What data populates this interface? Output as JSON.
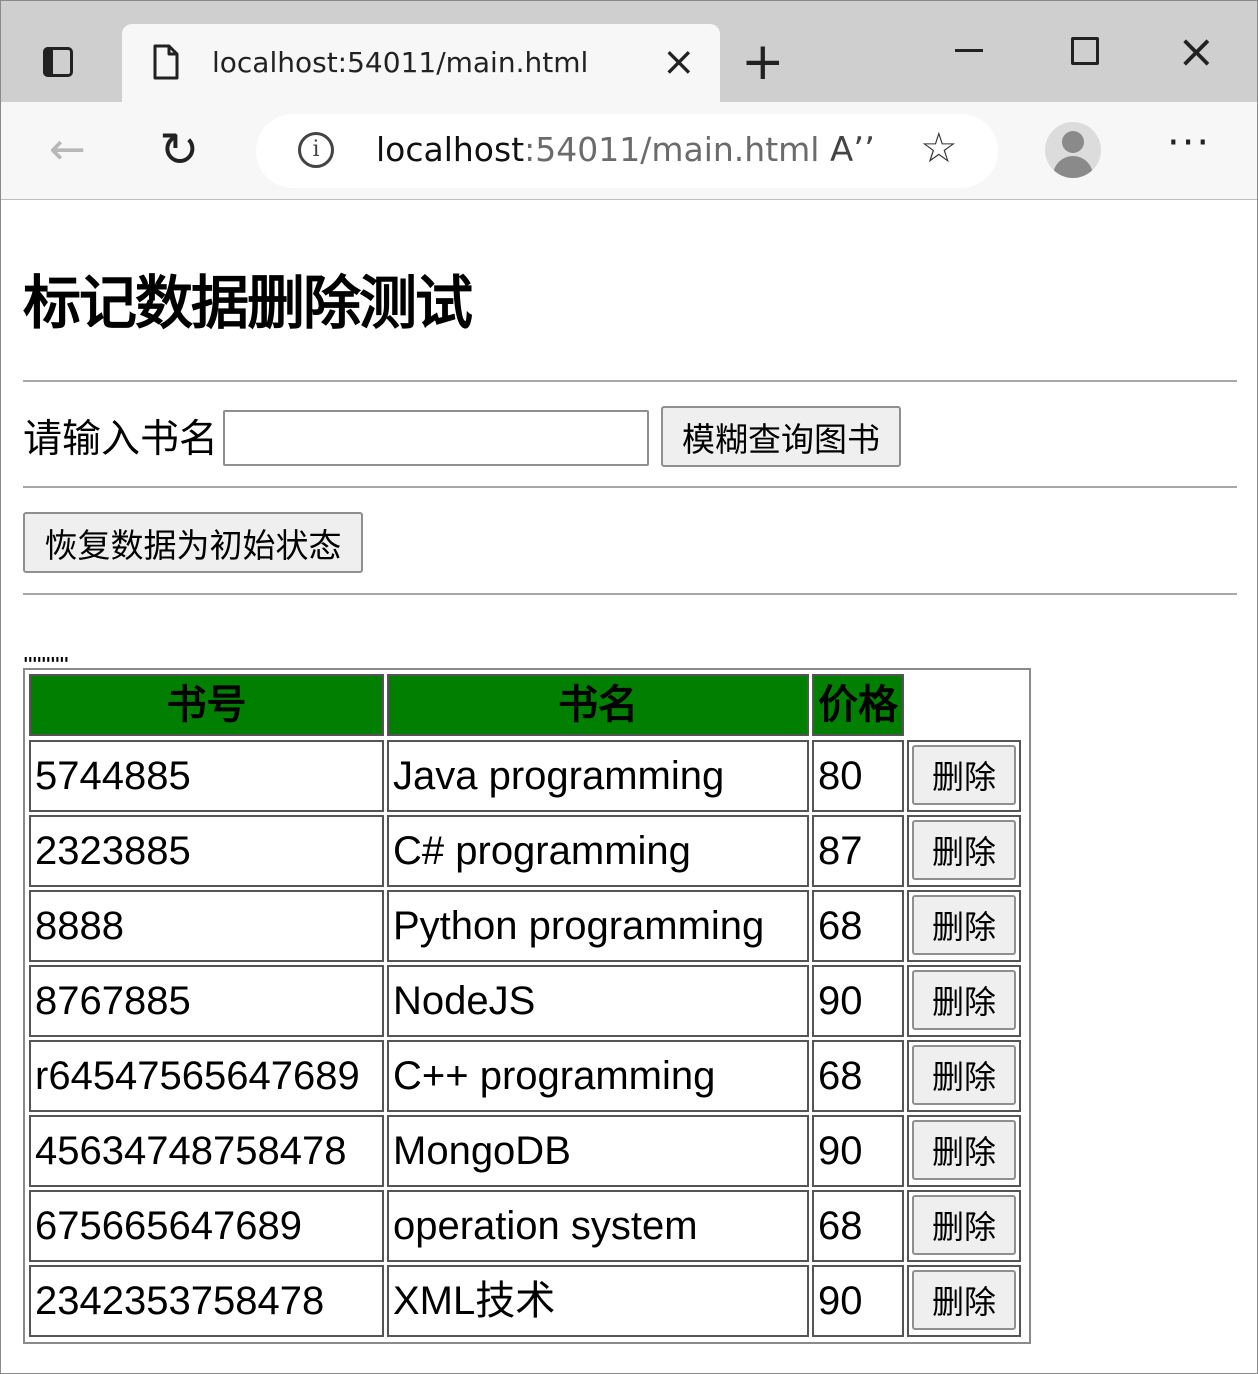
{
  "browser": {
    "tab_title": "localhost:54011/main.html",
    "new_tab_glyph": "+",
    "close_glyph": "×",
    "url_host": "localhost",
    "url_rest": ":54011/main.html",
    "icons": [
      "tab-actions-icon",
      "page-icon",
      "close-icon",
      "plus-icon",
      "minimize-icon",
      "maximize-icon",
      "back-arrow-icon",
      "refresh-icon",
      "info-icon",
      "read-aloud-icon",
      "favorite-star-icon",
      "profile-avatar",
      "more-options-icon"
    ]
  },
  "page": {
    "title": "标记数据删除测试",
    "search_label": "请输入书名",
    "search_value": "",
    "search_button": "模糊查询图书",
    "reset_button": "恢复数据为初始状态",
    "marker_strip": "''''''''''"
  },
  "table": {
    "header_color": "#007f00",
    "headers": [
      "书号",
      "书名",
      "价格"
    ],
    "delete_label": "删除",
    "rows": [
      {
        "id": "5744885",
        "name": "Java programming",
        "price": "80"
      },
      {
        "id": "2323885",
        "name": "C# programming",
        "price": "87"
      },
      {
        "id": "8888",
        "name": "Python programming",
        "price": "68"
      },
      {
        "id": "8767885",
        "name": "NodeJS",
        "price": "90"
      },
      {
        "id": "r64547565647689",
        "name": "C++ programming",
        "price": "68"
      },
      {
        "id": "45634748758478",
        "name": "MongoDB",
        "price": "90"
      },
      {
        "id": "675665647689",
        "name": "operation system",
        "price": "68"
      },
      {
        "id": "2342353758478",
        "name": "XML技术",
        "price": "90"
      }
    ]
  }
}
